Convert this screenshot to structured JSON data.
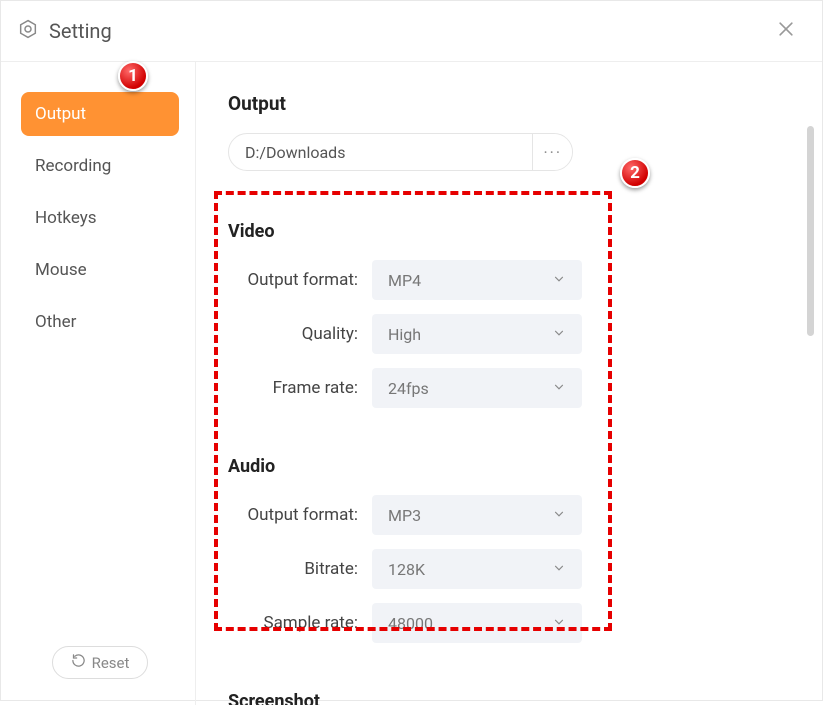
{
  "window": {
    "title": "Setting"
  },
  "sidebar": {
    "items": [
      {
        "label": "Output",
        "active": true
      },
      {
        "label": "Recording",
        "active": false
      },
      {
        "label": "Hotkeys",
        "active": false
      },
      {
        "label": "Mouse",
        "active": false
      },
      {
        "label": "Other",
        "active": false
      }
    ],
    "reset_label": "Reset"
  },
  "output": {
    "heading": "Output",
    "path_value": "D:/Downloads",
    "browse_label": "···"
  },
  "video": {
    "heading": "Video",
    "format_label": "Output format:",
    "format_value": "MP4",
    "quality_label": "Quality:",
    "quality_value": "High",
    "framerate_label": "Frame rate:",
    "framerate_value": "24fps"
  },
  "audio": {
    "heading": "Audio",
    "format_label": "Output format:",
    "format_value": "MP3",
    "bitrate_label": "Bitrate:",
    "bitrate_value": "128K",
    "samplerate_label": "Sample rate:",
    "samplerate_value": "48000"
  },
  "screenshot": {
    "heading": "Screenshot"
  },
  "annotations": {
    "badge1": "1",
    "badge2": "2"
  }
}
